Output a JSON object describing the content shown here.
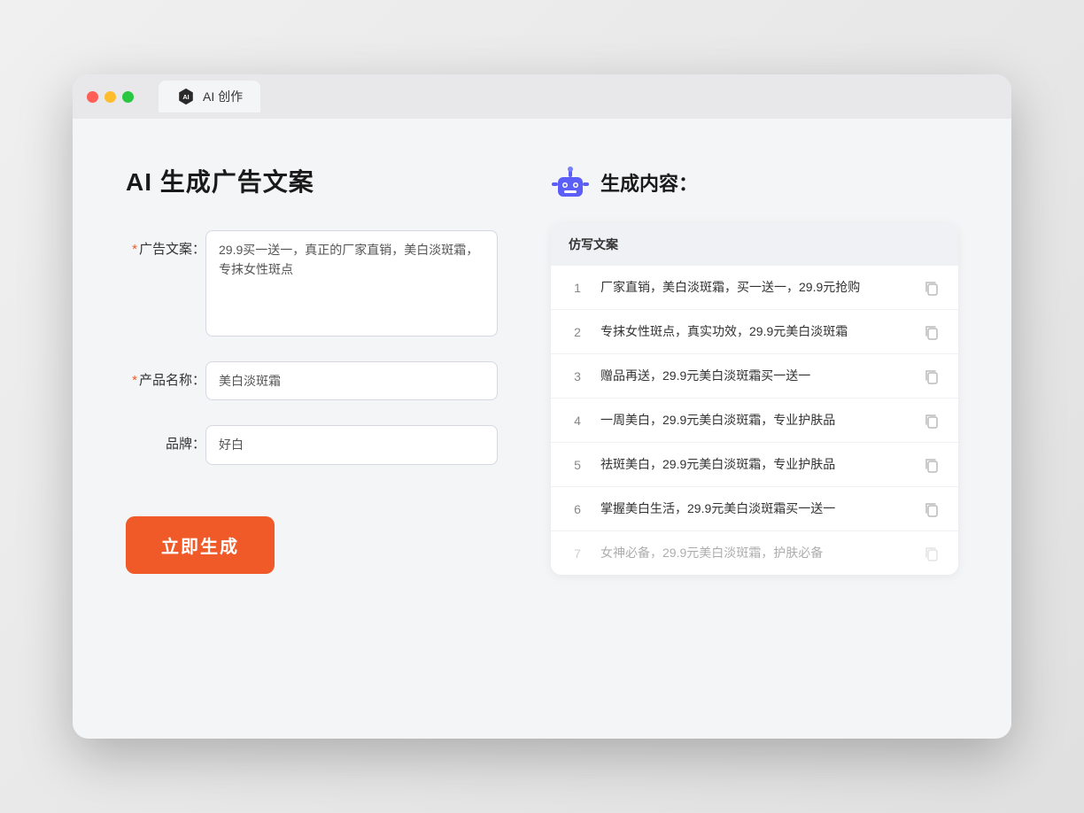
{
  "window": {
    "tab_label": "AI 创作"
  },
  "page": {
    "title": "AI 生成广告文案",
    "result_title": "生成内容："
  },
  "form": {
    "ad_copy_label": "广告文案：",
    "ad_copy_required": "*",
    "ad_copy_value": "29.9买一送一，真正的厂家直销，美白淡斑霜，专抹女性斑点",
    "product_name_label": "产品名称：",
    "product_name_required": "*",
    "product_name_value": "美白淡斑霜",
    "brand_label": "品牌：",
    "brand_value": "好白",
    "generate_button": "立即生成"
  },
  "result": {
    "table_header": "仿写文案",
    "rows": [
      {
        "num": "1",
        "text": "厂家直销，美白淡斑霜，买一送一，29.9元抢购",
        "faded": false
      },
      {
        "num": "2",
        "text": "专抹女性斑点，真实功效，29.9元美白淡斑霜",
        "faded": false
      },
      {
        "num": "3",
        "text": "赠品再送，29.9元美白淡斑霜买一送一",
        "faded": false
      },
      {
        "num": "4",
        "text": "一周美白，29.9元美白淡斑霜，专业护肤品",
        "faded": false
      },
      {
        "num": "5",
        "text": "祛斑美白，29.9元美白淡斑霜，专业护肤品",
        "faded": false
      },
      {
        "num": "6",
        "text": "掌握美白生活，29.9元美白淡斑霜买一送一",
        "faded": false
      },
      {
        "num": "7",
        "text": "女神必备，29.9元美白淡斑霜，护肤必备",
        "faded": true
      }
    ]
  }
}
